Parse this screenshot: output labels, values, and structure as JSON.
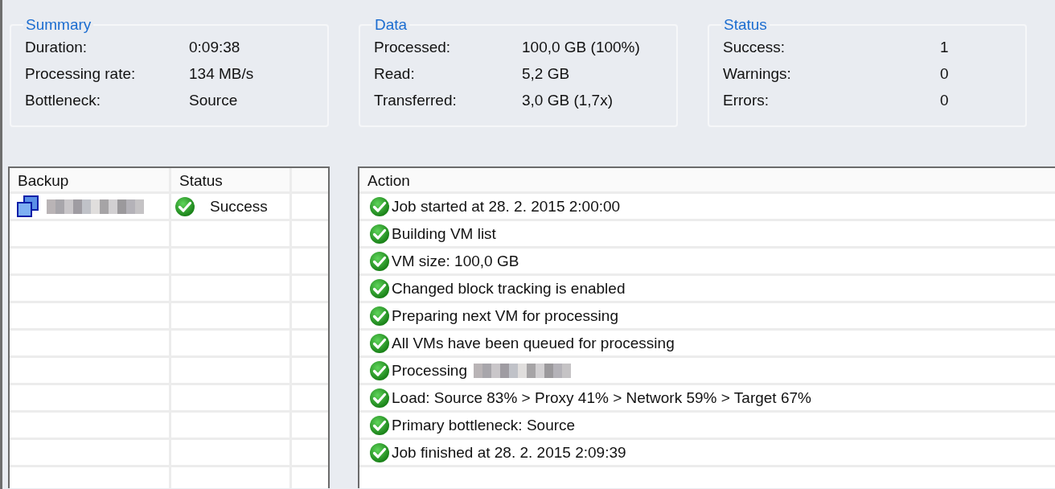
{
  "groups": [
    {
      "title": "Summary",
      "rows": [
        {
          "label": "Duration:",
          "value": "0:09:38"
        },
        {
          "label": "Processing rate:",
          "value": "134 MB/s"
        },
        {
          "label": "Bottleneck:",
          "value": "Source"
        }
      ]
    },
    {
      "title": "Data",
      "rows": [
        {
          "label": "Processed:",
          "value": "100,0 GB (100%)"
        },
        {
          "label": "Read:",
          "value": "5,2 GB"
        },
        {
          "label": "Transferred:",
          "value": "3,0 GB (1,7x)"
        }
      ]
    },
    {
      "title": "Status",
      "rows": [
        {
          "label": "Success:",
          "value": "1"
        },
        {
          "label": "Warnings:",
          "value": "0"
        },
        {
          "label": "Errors:",
          "value": "0"
        }
      ]
    }
  ],
  "backups": {
    "columns": [
      "Backup",
      "Status"
    ],
    "rows": [
      {
        "name_redacted": true,
        "status": "Success",
        "kind": "success"
      }
    ]
  },
  "actions": {
    "column": "Action",
    "rows": [
      {
        "kind": "success",
        "text": "Job started at 28. 2. 2015 2:00:00",
        "redacted_suffix": false
      },
      {
        "kind": "success",
        "text": "Building VM list",
        "redacted_suffix": false
      },
      {
        "kind": "success",
        "text": "VM size: 100,0 GB",
        "redacted_suffix": false
      },
      {
        "kind": "success",
        "text": "Changed block tracking is enabled",
        "redacted_suffix": false
      },
      {
        "kind": "success",
        "text": "Preparing next VM for processing",
        "redacted_suffix": false
      },
      {
        "kind": "success",
        "text": "All VMs have been queued for processing",
        "redacted_suffix": false
      },
      {
        "kind": "success",
        "text": "Processing",
        "redacted_suffix": true
      },
      {
        "kind": "success",
        "text": "Load: Source 83% > Proxy 41% > Network 59% > Target 67%",
        "redacted_suffix": false
      },
      {
        "kind": "success",
        "text": "Primary bottleneck: Source",
        "redacted_suffix": false
      },
      {
        "kind": "success",
        "text": "Job finished at 28. 2. 2015 2:09:39",
        "redacted_suffix": false
      }
    ]
  }
}
